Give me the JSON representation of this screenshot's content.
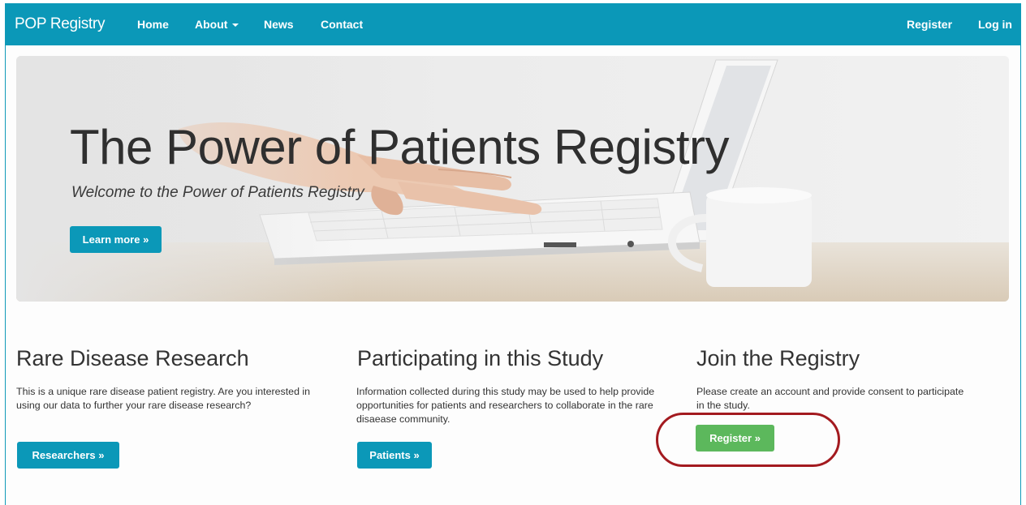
{
  "navbar": {
    "brand": "POP Registry",
    "links": [
      "Home",
      "About",
      "News",
      "Contact"
    ],
    "right_links": [
      "Register",
      "Log in"
    ]
  },
  "hero": {
    "title": "The Power of Patients Registry",
    "subtitle": "Welcome to the Power of Patients Registry",
    "button": "Learn more »"
  },
  "columns": [
    {
      "title": "Rare Disease Research",
      "text": "This is a unique rare disease patient registry. Are you interested in using our data to further your rare disease research?",
      "button": "Researchers »"
    },
    {
      "title": "Participating in this Study",
      "text": "Information collected during this study may be used to help provide opportunities for patients and researchers to collaborate in the rare disaease community.",
      "button": "Patients »"
    },
    {
      "title": "Join the Registry",
      "text": "Please create an account and provide consent to participate in the study.",
      "button": "Register »"
    }
  ],
  "colors": {
    "navbar": "#0b98b8",
    "info_button": "#0b98b8",
    "success_button": "#5cb85c",
    "highlight_ring": "#a31a1f"
  }
}
